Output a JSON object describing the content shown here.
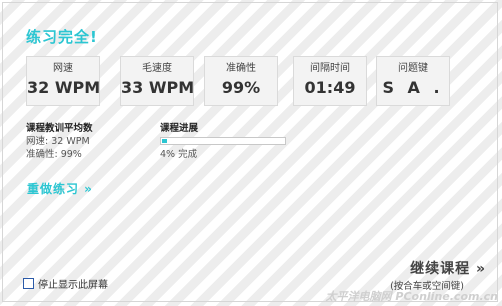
{
  "header": {
    "title": "练习完全!"
  },
  "stats": [
    {
      "label": "网速",
      "value": "32 WPM"
    },
    {
      "label": "毛速度",
      "value": "33 WPM"
    },
    {
      "label": "准确性",
      "value": "99%"
    },
    {
      "label": "间隔时间",
      "value": "01:49"
    },
    {
      "label": "问题键",
      "value": "S A ."
    }
  ],
  "average": {
    "heading": "课程教训平均数",
    "speed": "网速: 32 WPM",
    "accuracy": "准确性: 99%"
  },
  "progress": {
    "heading": "课程进展",
    "fraction": 0.04,
    "text": "4% 完成"
  },
  "actions": {
    "redo": "重做练习 »",
    "stop_label": "停止显示此屏幕",
    "continue_label": "继续课程 »",
    "continue_hint": "(按合车或空间键)"
  },
  "watermark": "太平洋电脑网 PConline.com.cn",
  "colors": {
    "accent": "#2cc6d2"
  }
}
